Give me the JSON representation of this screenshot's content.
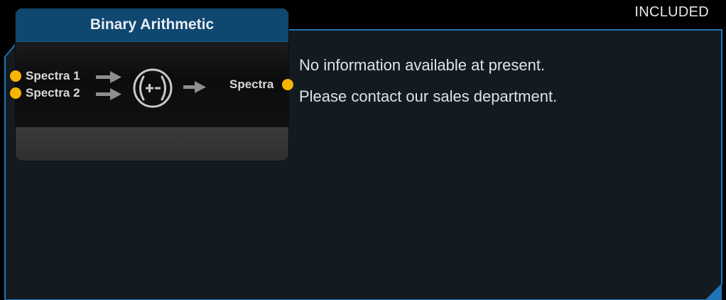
{
  "status_badge": "INCLUDED",
  "node": {
    "title": "Binary Arithmetic",
    "inputs": [
      "Spectra 1",
      "Spectra 2"
    ],
    "output": "Spectra",
    "operator_icon": "plus-minus-icon",
    "port_color": "#f7b500",
    "header_color": "#0f4770"
  },
  "info": {
    "line1": "No information available at present.",
    "line2": "Please contact our sales department."
  },
  "colors": {
    "panel_border": "#1f74b8",
    "panel_fill": "#131a20"
  }
}
